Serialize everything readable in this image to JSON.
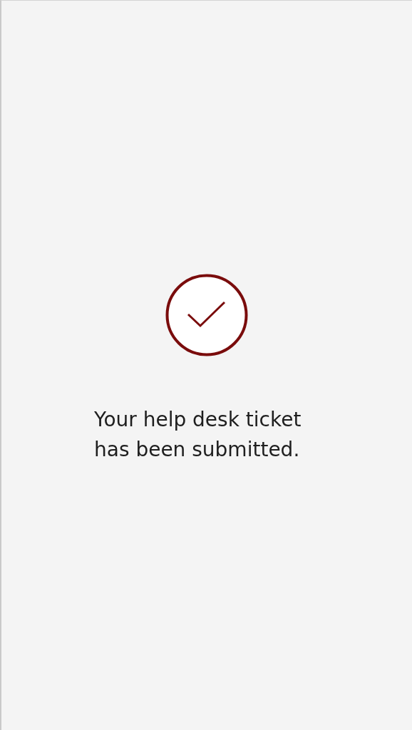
{
  "confirmation": {
    "submitted": true,
    "message": "Your help desk ticket has been submitted."
  }
}
